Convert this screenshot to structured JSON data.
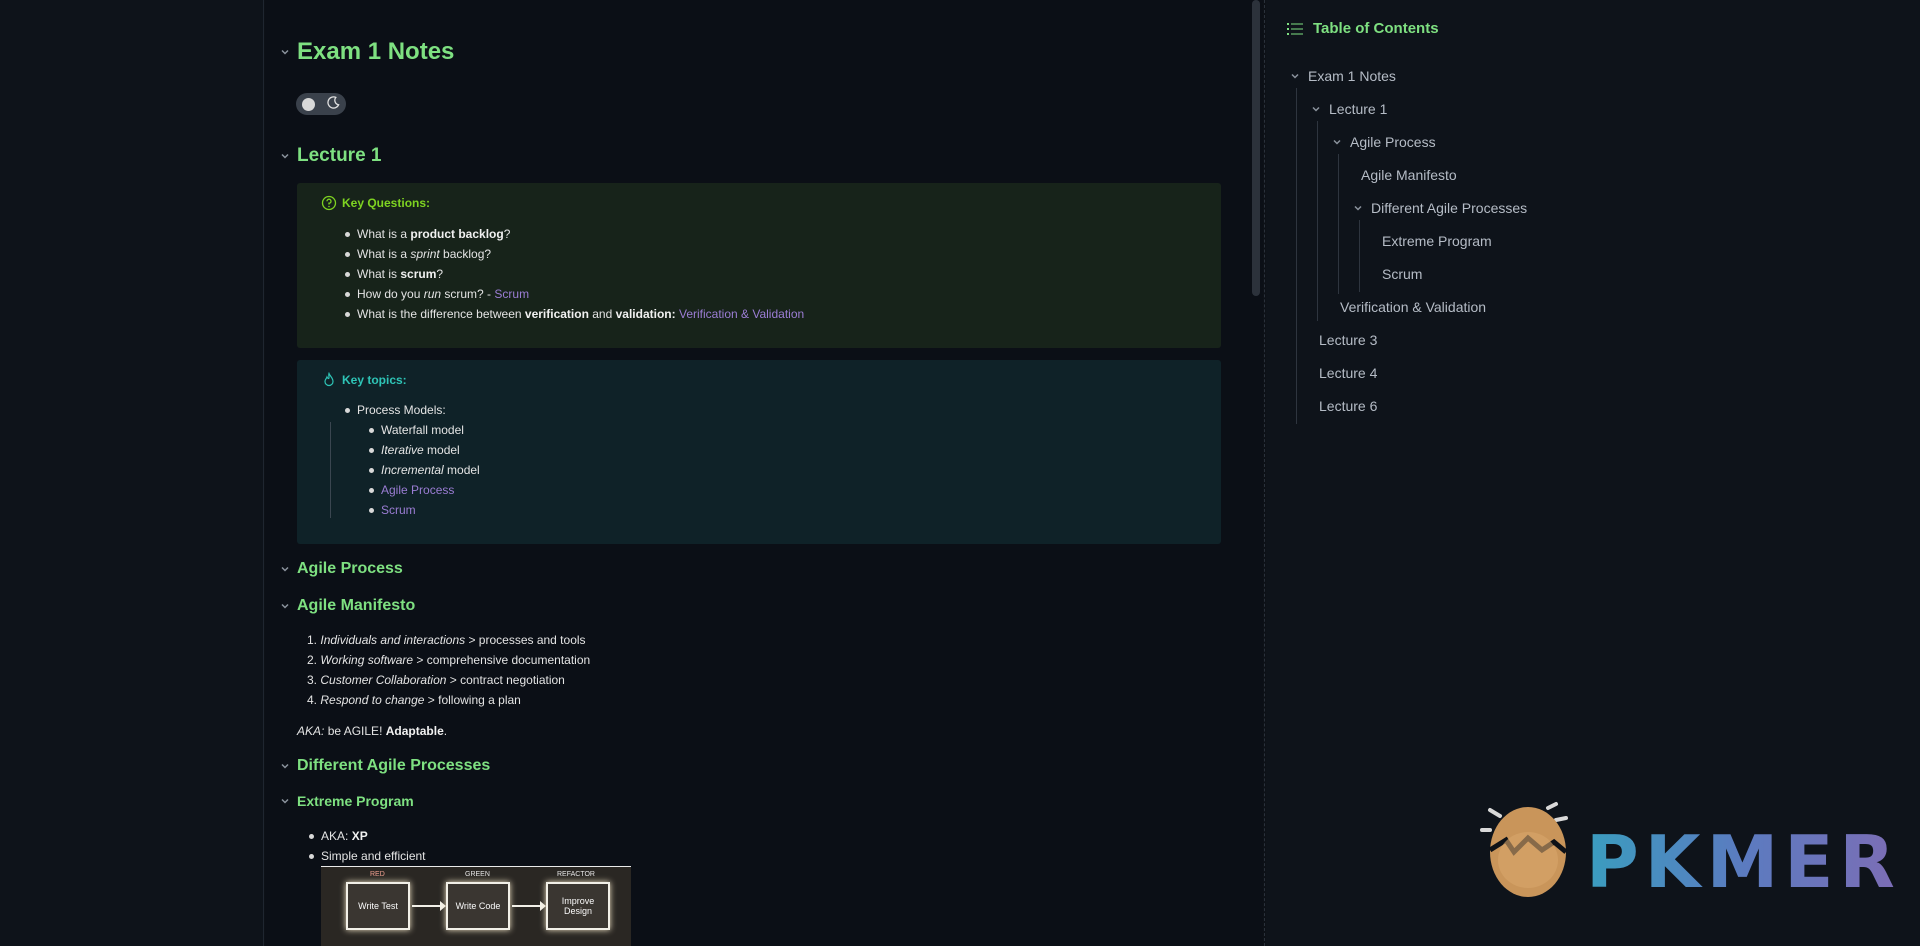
{
  "editor": {
    "headings": {
      "exam": "Exam 1 Notes",
      "lecture1": "Lecture 1",
      "agile_process": "Agile Process",
      "agile_manifesto": "Agile Manifesto",
      "different_processes": "Different Agile Processes",
      "extreme_program": "Extreme Program"
    },
    "key_questions": {
      "title": "Key Questions:",
      "items": [
        {
          "pre": "What is a ",
          "bold": "product backlog",
          "post": "?"
        },
        {
          "pre": "What is a ",
          "em": "sprint",
          "post": " backlog?"
        },
        {
          "pre": "What is ",
          "bold": "scrum",
          "post": "?"
        },
        {
          "pre": "How do you ",
          "em": "run",
          "mid": " scrum? - ",
          "link": "Scrum"
        },
        {
          "pre": "What is the difference between ",
          "bold1": "verification",
          "mid": " and ",
          "bold2": "validation:",
          "link": "Verification & Validation"
        }
      ]
    },
    "key_topics": {
      "title": "Key topics:",
      "parent": "Process Models:",
      "children": [
        {
          "text": "Waterfall model"
        },
        {
          "em": "Iterative",
          "post": " model"
        },
        {
          "em": "Incremental",
          "post": " model"
        },
        {
          "link": "Agile Process"
        },
        {
          "link": "Scrum"
        }
      ]
    },
    "manifesto": [
      {
        "num": "1.",
        "em": "Individuals and interactions",
        "post": " > processes and tools"
      },
      {
        "num": "2.",
        "em": "Working software",
        "post": " > comprehensive documentation"
      },
      {
        "num": "3.",
        "em": "Customer Collaboration",
        "post": " > contract negotiation"
      },
      {
        "num": "4.",
        "em": "Respond to change",
        "post": " > following a plan"
      }
    ],
    "aka": {
      "em": "AKA:",
      "mid": " be AGILE! ",
      "bold": "Adaptable",
      "post": "."
    },
    "xp_items": [
      {
        "pre": "AKA: ",
        "bold": "XP"
      },
      {
        "pre": "Simple and efficient"
      }
    ],
    "xp_diagram": {
      "labels": [
        "RED",
        "GREEN",
        "REFACTOR"
      ],
      "boxes": [
        "Write Test",
        "Write Code",
        "Improve Design"
      ]
    }
  },
  "toc": {
    "title": "Table of Contents",
    "items": [
      {
        "label": "Exam 1 Notes"
      },
      {
        "label": "Lecture 1"
      },
      {
        "label": "Agile Process"
      },
      {
        "label": "Agile Manifesto"
      },
      {
        "label": "Different Agile Processes"
      },
      {
        "label": "Extreme Program"
      },
      {
        "label": "Scrum"
      },
      {
        "label": "Verification & Validation"
      },
      {
        "label": "Lecture 3"
      },
      {
        "label": "Lecture 4"
      },
      {
        "label": "Lecture 6"
      }
    ]
  },
  "watermark": {
    "text": "PKMER"
  },
  "colors": {
    "heading": "#7ee081",
    "link": "#9b7dd4",
    "question_accent": "#7ed321",
    "topic_accent": "#2ec4b6"
  },
  "icons": {
    "toggle": "moon-icon",
    "questions": "question-circle-icon",
    "topics": "flame-icon",
    "toc": "list-icon"
  }
}
